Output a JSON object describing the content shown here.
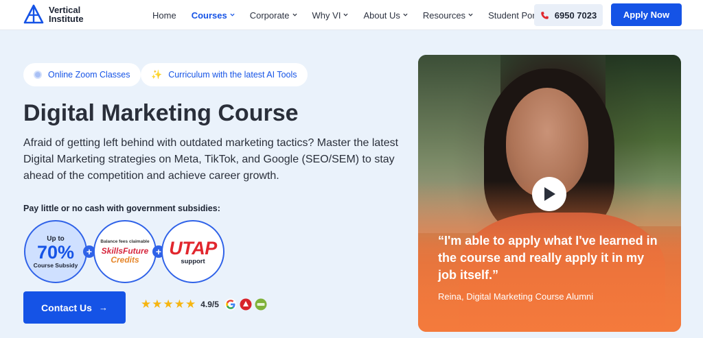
{
  "header": {
    "logo_line1": "Vertical",
    "logo_line2": "Institute",
    "nav": [
      {
        "label": "Home",
        "dropdown": false,
        "active": false
      },
      {
        "label": "Courses",
        "dropdown": true,
        "active": true
      },
      {
        "label": "Corporate",
        "dropdown": true,
        "active": false
      },
      {
        "label": "Why VI",
        "dropdown": true,
        "active": false
      },
      {
        "label": "About Us",
        "dropdown": true,
        "active": false
      },
      {
        "label": "Resources",
        "dropdown": true,
        "active": false
      },
      {
        "label": "Student Portal",
        "dropdown": false,
        "active": false
      }
    ],
    "phone": "6950 7023",
    "apply_label": "Apply Now"
  },
  "hero": {
    "pill_1": "Online Zoom Classes",
    "pill_2": "Curriculum with the latest AI Tools",
    "title": "Digital Marketing Course",
    "description": "Afraid of getting left behind with outdated marketing tactics? Master the latest Digital Marketing strategies on Meta, TikTok, and Google (SEO/SEM) to stay ahead of the competition and achieve career growth.",
    "subsidy_label": "Pay little or no cash with government subsidies:",
    "badge_subsidy": {
      "top": "Up to",
      "value": "70%",
      "bottom": "Course Subsidy"
    },
    "badge_skillsfuture": {
      "note": "Balance fees claimable",
      "line1": "SkillsFuture",
      "line2": "Credits"
    },
    "badge_utap": {
      "value": "UTAP",
      "bottom": "support"
    },
    "plus": "+",
    "contact_label": "Contact Us",
    "contact_arrow": "→",
    "rating": {
      "stars": 5,
      "score": "4.9/5"
    }
  },
  "video": {
    "quote": "“I'm able to apply what I've learned in the course and really apply it in my job itself.”",
    "author": "Reina, Digital Marketing Course Alumni"
  },
  "colors": {
    "brand_blue": "#1553e6",
    "background": "#eaf2fb",
    "card_orange": "#f47a3c"
  }
}
